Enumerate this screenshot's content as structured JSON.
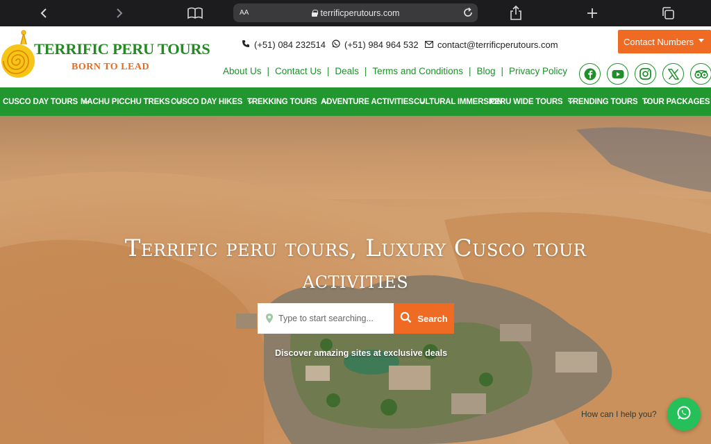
{
  "browser": {
    "aa_label": "AA",
    "url": "terrificperutours.com",
    "icons": [
      "back-chevron-icon",
      "forward-chevron-icon",
      "bookmarks-icon",
      "lock-icon",
      "reload-icon",
      "share-icon",
      "new-tab-icon",
      "tabs-icon"
    ]
  },
  "header": {
    "brand_name": "TERRIFIC PERU TOURS",
    "tagline": "BORN TO LEAD",
    "phone": "(+51) 084 232514",
    "whatsapp": "(+51) 984 964 532",
    "email": "contact@terrificperutours.com",
    "contact_button": "Contact Numbers",
    "links": [
      "About Us",
      "Contact Us",
      "Deals",
      "Terms and Conditions",
      "Blog",
      "Privacy Policy"
    ],
    "social_icons": [
      "facebook-icon",
      "youtube-icon",
      "instagram-icon",
      "x-icon",
      "tripadvisor-icon"
    ]
  },
  "menu": {
    "items": [
      "CUSCO DAY TOURS",
      "MACHU PICCHU TREKS",
      "CUSCO DAY HIKES",
      "TREKKING TOURS",
      "ADVENTURE ACTIVITIES",
      "CULTURAL IMMERSION",
      "PERU WIDE TOURS",
      "TRENDING TOURS",
      "TOUR PACKAGES"
    ]
  },
  "hero": {
    "title_line1": "Terrific peru tours, Luxury Cusco tour",
    "title_line2": "activities",
    "search_placeholder": "Type to start searching...",
    "search_button": "Search",
    "subtitle": "Discover amazing sites at exclusive deals",
    "help_text": "How can I help you?"
  },
  "colors": {
    "brand_green": "#22962f",
    "accent_orange": "#ef6a22",
    "whatsapp_green": "#25c05a"
  }
}
